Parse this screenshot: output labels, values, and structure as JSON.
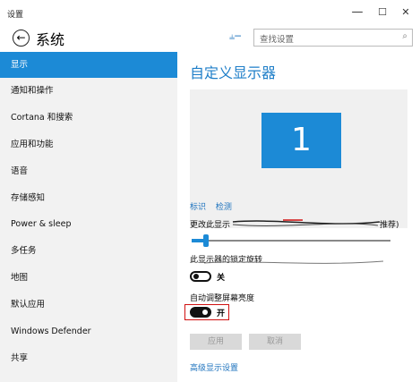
{
  "window": {
    "title": "设置",
    "minimize": "—",
    "maximize": "☐",
    "close": "✕"
  },
  "header": {
    "back_icon": "back-arrow-icon",
    "title": "系统",
    "pin_icon": "pin-icon",
    "search_placeholder": "查找设置",
    "search_icon": "search-icon"
  },
  "sidebar": {
    "items": [
      {
        "label": "显示",
        "active": true
      },
      {
        "label": "通知和操作"
      },
      {
        "label": "Cortana 和搜索"
      },
      {
        "label": "应用和功能"
      },
      {
        "label": "语音"
      },
      {
        "label": "存储感知"
      },
      {
        "label": "Power & sleep"
      },
      {
        "label": "多任务"
      },
      {
        "label": "地图"
      },
      {
        "label": "默认应用"
      },
      {
        "label": "Windows Defender"
      },
      {
        "label": "共享"
      }
    ]
  },
  "main": {
    "heading": "自定义显示器",
    "monitor_number": "1",
    "identify_link": "标识",
    "detect_link": "检测",
    "scale_label": "更改此显示",
    "scale_label_tail": "推荐)",
    "scale_slider_level": 0.07,
    "rotation_lock_label": "此显示器的锁定旋转",
    "rotation_lock_state": "关",
    "auto_brightness_label": "自动调整屏幕亮度",
    "auto_brightness_state": "开",
    "apply_button": "应用",
    "cancel_button": "取消",
    "advanced_link": "高级显示设置"
  },
  "colors": {
    "accent": "#1c8ad6",
    "highlight_box": "#d01010"
  }
}
